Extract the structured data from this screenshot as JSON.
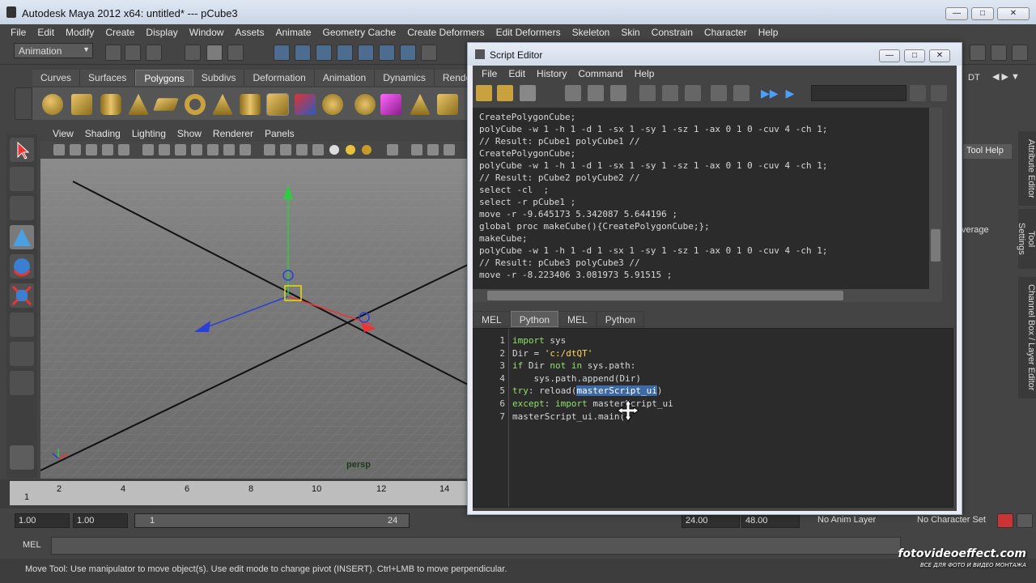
{
  "window": {
    "title": "Autodesk Maya 2012 x64: untitled*   ---   pCube3"
  },
  "menubar": [
    "File",
    "Edit",
    "Modify",
    "Create",
    "Display",
    "Window",
    "Assets",
    "Animate",
    "Geometry Cache",
    "Create Deformers",
    "Edit Deformers",
    "Skeleton",
    "Skin",
    "Constrain",
    "Character",
    "Help"
  ],
  "statusline": {
    "mode": "Animation"
  },
  "shelf": {
    "tabs": [
      "Curves",
      "Surfaces",
      "Polygons",
      "Subdivs",
      "Deformation",
      "Animation",
      "Dynamics",
      "Rendering"
    ],
    "active": "Polygons"
  },
  "viewport": {
    "menu": [
      "View",
      "Shading",
      "Lighting",
      "Show",
      "Renderer",
      "Panels"
    ],
    "camera_label": "persp"
  },
  "timeline": {
    "ticks": [
      "1",
      "2",
      "4",
      "6",
      "8",
      "10",
      "12",
      "14"
    ]
  },
  "rangebar": {
    "start_time": "1.00",
    "playback_start": "1.00",
    "range_start": "1",
    "range_end": "24",
    "playback_end": "24.00",
    "end_time": "48.00",
    "anim_layer": "No Anim Layer",
    "character_set": "No Character Set"
  },
  "cmdline": {
    "label": "MEL"
  },
  "helpline": {
    "text": "Move Tool: Use manipulator to move object(s). Use edit mode to change pivot (INSERT).  Ctrl+LMB to move perpendicular."
  },
  "rightpanel": {
    "dt_label": "DT",
    "tool_help": "Tool Help",
    "average_text": "verage",
    "vertical_tabs": [
      "Attribute Editor",
      "Tool Settings",
      "Channel Box / Layer Editor"
    ]
  },
  "script_editor": {
    "title": "Script Editor",
    "menu": [
      "File",
      "Edit",
      "History",
      "Command",
      "Help"
    ],
    "history": [
      "CreatePolygonCube;",
      "polyCube -w 1 -h 1 -d 1 -sx 1 -sy 1 -sz 1 -ax 0 1 0 -cuv 4 -ch 1;",
      "// Result: pCube1 polyCube1 //",
      "CreatePolygonCube;",
      "polyCube -w 1 -h 1 -d 1 -sx 1 -sy 1 -sz 1 -ax 0 1 0 -cuv 4 -ch 1;",
      "// Result: pCube2 polyCube2 //",
      "select -cl  ;",
      "select -r pCube1 ;",
      "move -r -9.645173 5.342087 5.644196 ;",
      "global proc makeCube(){CreatePolygonCube;};",
      "makeCube;",
      "polyCube -w 1 -h 1 -d 1 -sx 1 -sy 1 -sz 1 -ax 0 1 0 -cuv 4 -ch 1;",
      "// Result: pCube3 polyCube3 //",
      "move -r -8.223406 3.081973 5.91515 ;"
    ],
    "tabs": [
      "MEL",
      "Python",
      "MEL",
      "Python"
    ],
    "active_tab": 1,
    "line_numbers": [
      "1",
      "2",
      "3",
      "4",
      "5",
      "6",
      "7"
    ],
    "code": {
      "l1_kw": "import",
      "l1_rest": " sys",
      "l2_a": "Dir = ",
      "l2_str": "'c:/dtQT'",
      "l3_kw1": "if",
      "l3_b": " Dir ",
      "l3_kw2": "not in",
      "l3_c": " sys.path:",
      "l4": "    sys.path.append(Dir)",
      "l5_kw": "try",
      "l5_a": ": reload(",
      "l5_sel": "masterScript_ui",
      "l5_b": ")",
      "l6_kw1": "except",
      "l6_a": ": ",
      "l6_kw2": "import",
      "l6_b": " masterScript_ui",
      "l7": "masterScript_ui.main()"
    }
  },
  "watermark": {
    "line1": "fotovideoeffect.com",
    "line2": "ВСЕ ДЛЯ ФОТО И ВИДЕО МОНТАЖА"
  }
}
